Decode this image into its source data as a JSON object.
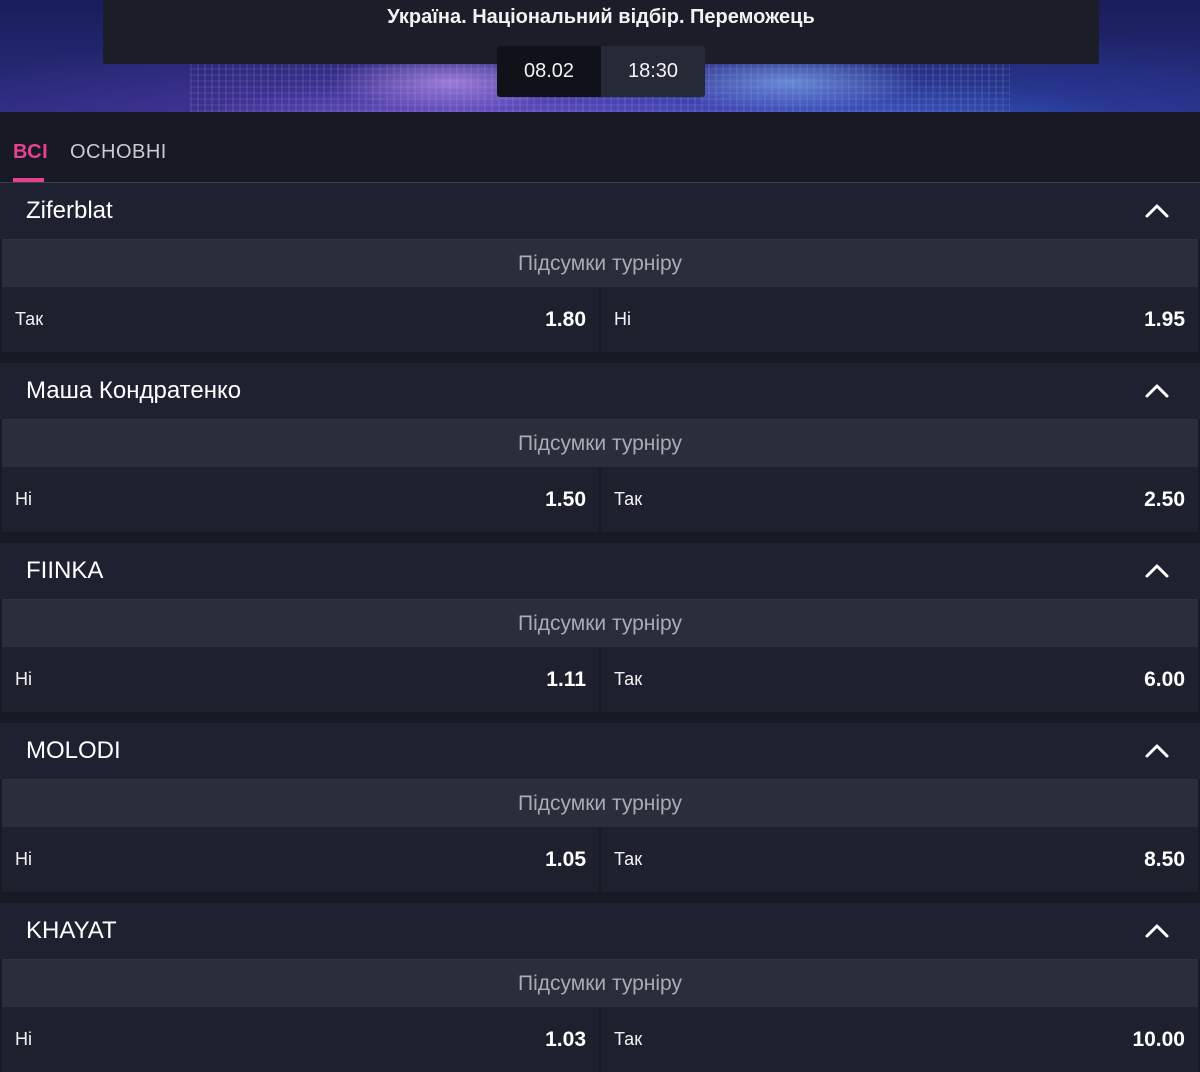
{
  "event": {
    "title": "Україна. Національний відбір. Переможець",
    "date": "08.02",
    "time": "18:30"
  },
  "tabs": [
    {
      "label": "ВСІ",
      "active": true
    },
    {
      "label": "ОСНОВНІ",
      "active": false
    }
  ],
  "markets": [
    {
      "name": "Ziferblat",
      "subtitle": "Підсумки турніру",
      "odds": [
        {
          "label": "Так",
          "value": "1.80"
        },
        {
          "label": "Ні",
          "value": "1.95"
        }
      ]
    },
    {
      "name": "Маша Кондратенко",
      "subtitle": "Підсумки турніру",
      "odds": [
        {
          "label": "Ні",
          "value": "1.50"
        },
        {
          "label": "Так",
          "value": "2.50"
        }
      ]
    },
    {
      "name": "FIINKA",
      "subtitle": "Підсумки турніру",
      "odds": [
        {
          "label": "Ні",
          "value": "1.11"
        },
        {
          "label": "Так",
          "value": "6.00"
        }
      ]
    },
    {
      "name": "MOLODI",
      "subtitle": "Підсумки турніру",
      "odds": [
        {
          "label": "Ні",
          "value": "1.05"
        },
        {
          "label": "Так",
          "value": "8.50"
        }
      ]
    },
    {
      "name": "KHAYAT",
      "subtitle": "Підсумки турніру",
      "odds": [
        {
          "label": "Ні",
          "value": "1.03"
        },
        {
          "label": "Так",
          "value": "10.00"
        }
      ]
    }
  ],
  "icons": {
    "collapse": "chevron-up-icon"
  },
  "colors": {
    "accent": "#e8418f",
    "background": "#171924",
    "market_header": "#1e2130",
    "subheader": "#2a2d3a",
    "odd_cell": "#1d202d"
  }
}
